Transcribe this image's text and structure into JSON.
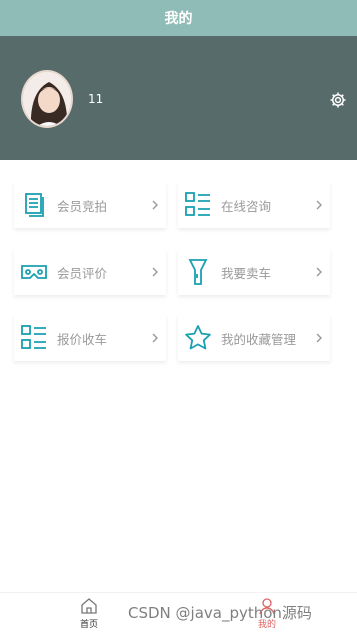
{
  "header": {
    "title": "我的",
    "username": "11"
  },
  "colors": {
    "nav": "#8fbcb6",
    "header": "#566b6a",
    "accent": "#1aa0b0",
    "tab_active": "#e06060"
  },
  "menu": [
    {
      "label": "会员竞拍",
      "icon": "document-stack-icon"
    },
    {
      "label": "在线咨询",
      "icon": "list-icon"
    },
    {
      "label": "会员评价",
      "icon": "vr-goggles-icon"
    },
    {
      "label": "我要卖车",
      "icon": "flashlight-icon"
    },
    {
      "label": "报价收车",
      "icon": "list-icon"
    },
    {
      "label": "我的收藏管理",
      "icon": "star-icon"
    }
  ],
  "tabbar": {
    "home_label": "首页",
    "mine_label": "我的"
  },
  "watermark": "CSDN @java_python源码"
}
